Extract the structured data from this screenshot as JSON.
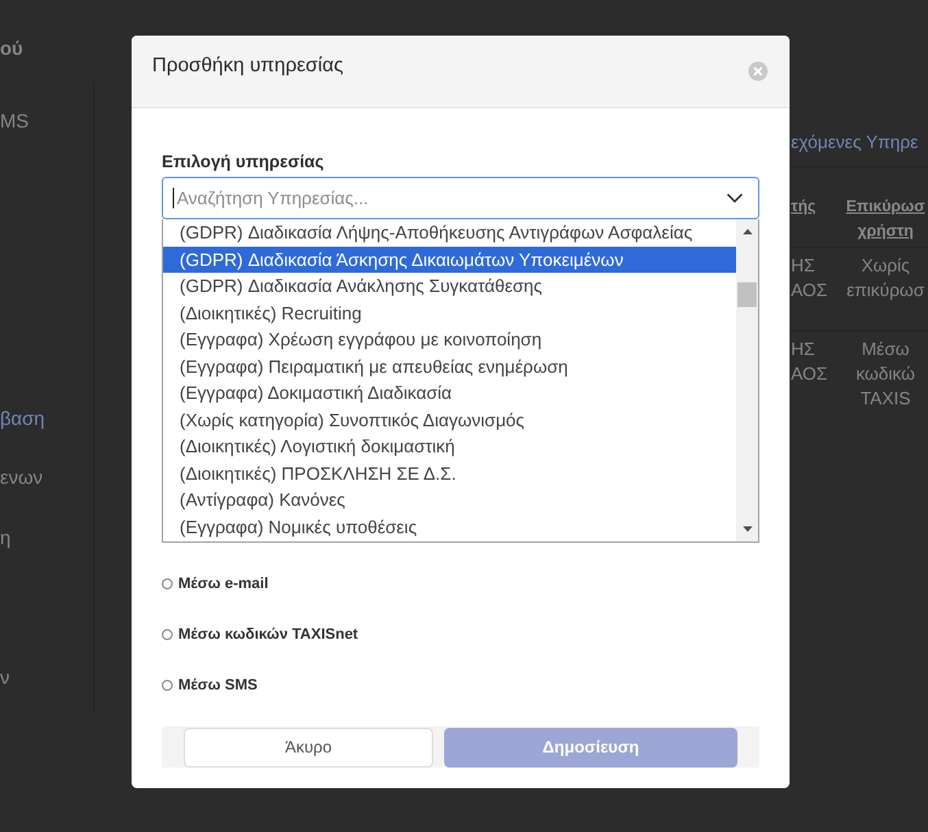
{
  "background_page": {
    "sidebar": {
      "title": "ού",
      "items": [
        {
          "label": "MS",
          "selected": false
        },
        {
          "label": "βαση",
          "selected": true
        },
        {
          "label": "ενων",
          "selected": false
        },
        {
          "label": "η",
          "selected": false
        },
        {
          "label": "ν",
          "selected": false
        }
      ]
    },
    "tab": {
      "label": "εχόμενες Υπηρε"
    },
    "table": {
      "columns": [
        "τής",
        "Επικύρωσ χρήστη"
      ],
      "rows": [
        [
          "ΗΣ ΑΟΣ",
          "Χωρίς επικύρωσ"
        ],
        [
          "ΗΣ ΑΟΣ",
          "Μέσω κωδικώ TAXIS"
        ]
      ]
    }
  },
  "dialog": {
    "title": "Προσθήκη υπηρεσίας",
    "service_field": {
      "label": "Επιλογή υπηρεσίας",
      "placeholder": "Αναζήτηση Υπηρεσίας...",
      "expanded": true,
      "options": [
        {
          "label": "(GDPR) Διαδικασία Λήψης-Αποθήκευσης Αντιγράφων Ασφαλείας",
          "selected": false
        },
        {
          "label": "(GDPR) Διαδικασία Άσκησης Δικαιωμάτων Υποκειμένων",
          "selected": true
        },
        {
          "label": "(GDPR) Διαδικασία Ανάκλησης Συγκατάθεσης",
          "selected": false
        },
        {
          "label": "(Διοικητικές) Recruiting",
          "selected": false
        },
        {
          "label": "(Εγγραφα) Χρέωση εγγράφου με κοινοποίηση",
          "selected": false
        },
        {
          "label": "(Εγγραφα) Πειραματική με απευθείας ενημέρωση",
          "selected": false
        },
        {
          "label": "(Εγγραφα) Δοκιμαστική Διαδικασία",
          "selected": false
        },
        {
          "label": "(Χωρίς κατηγορία) Συνοπτικός Διαγωνισμός",
          "selected": false
        },
        {
          "label": "(Διοικητικές) Λογιστική δοκιμαστική",
          "selected": false
        },
        {
          "label": "(Διοικητικές) ΠΡΟΣΚΛΗΣΗ ΣΕ Δ.Σ.",
          "selected": false
        },
        {
          "label": "(Αντίγραφα) Κανόνες",
          "selected": false
        },
        {
          "label": "(Εγγραφα) Νομικές υποθέσεις",
          "selected": false
        }
      ]
    },
    "verification_options": [
      {
        "label": "Μέσω e-mail",
        "selected": false
      },
      {
        "label": "Μέσω κωδικών TAXISnet",
        "selected": false
      },
      {
        "label": "Μέσω SMS",
        "selected": false
      }
    ],
    "buttons": [
      {
        "label": "Άκυρο",
        "kind": "secondary",
        "disabled": false
      },
      {
        "label": "Δημοσίευση",
        "kind": "primary",
        "disabled": true
      }
    ]
  }
}
